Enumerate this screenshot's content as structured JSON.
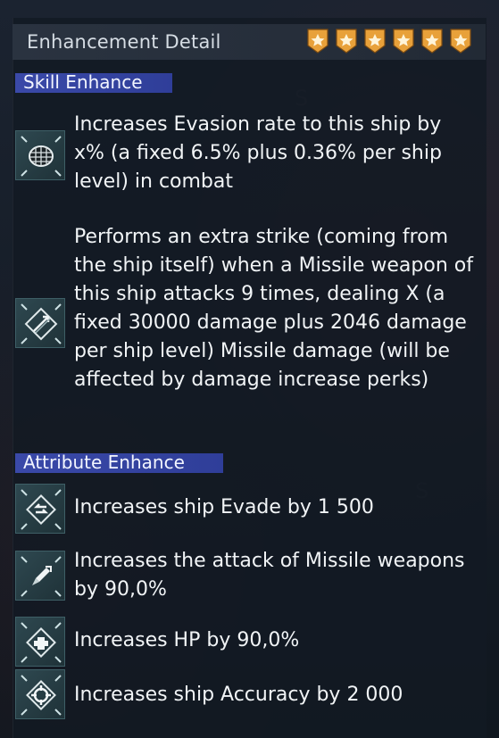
{
  "header": {
    "title": "Enhancement Detail",
    "star_count": 6,
    "star_color": "#e8a13a"
  },
  "skill_section": {
    "label": "Skill Enhance",
    "items": [
      {
        "icon": "evasion-net-icon",
        "text": "Increases Evasion rate to this ship by x% (a fixed 6.5% plus 0.36% per ship level) in combat"
      },
      {
        "icon": "missile-strike-icon",
        "text": "Performs an extra strike (coming from the ship itself) when a Missile weapon of this ship attacks 9 times, dealing X (a fixed 30000 damage plus 2046 damage per ship level) Missile damage (will be affected by damage increase perks)"
      }
    ]
  },
  "attribute_section": {
    "label": "Attribute Enhance",
    "items": [
      {
        "icon": "evade-arrows-icon",
        "text": "Increases ship Evade by 1 500"
      },
      {
        "icon": "missile-icon",
        "text": "Increases the attack of Missile weapons by 90,0%"
      },
      {
        "icon": "hp-cross-icon",
        "text": "Increases HP by 90,0%"
      },
      {
        "icon": "accuracy-crosshair-icon",
        "text": "Increases ship Accuracy by 2 000"
      }
    ]
  },
  "accent_color": "#3a49a8"
}
